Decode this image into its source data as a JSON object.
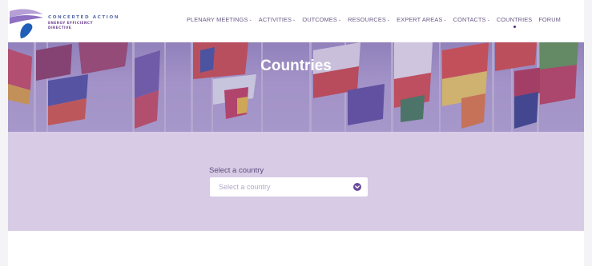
{
  "brand": {
    "line1": "CONCERTED ACTION",
    "line2": "ENERGY EFFICIENCY",
    "line3": "DIRECTIVE"
  },
  "nav": [
    {
      "label": "PLENARY MEETINGS",
      "dropdown": true
    },
    {
      "label": "ACTIVITIES",
      "dropdown": true
    },
    {
      "label": "OUTCOMES",
      "dropdown": true
    },
    {
      "label": "RESOURCES",
      "dropdown": true
    },
    {
      "label": "EXPERT AREAS",
      "dropdown": true
    },
    {
      "label": "CONTACTS",
      "dropdown": true
    },
    {
      "label": "COUNTRIES",
      "dropdown": false,
      "active": true
    },
    {
      "label": "FORUM",
      "dropdown": false
    }
  ],
  "hero": {
    "title": "Countries"
  },
  "country_select": {
    "label": "Select a country",
    "placeholder": "Select a country"
  },
  "colors": {
    "nav_text": "#6a5a86",
    "band_bg": "#d8cbe5",
    "accent": "#6a4a9a"
  }
}
